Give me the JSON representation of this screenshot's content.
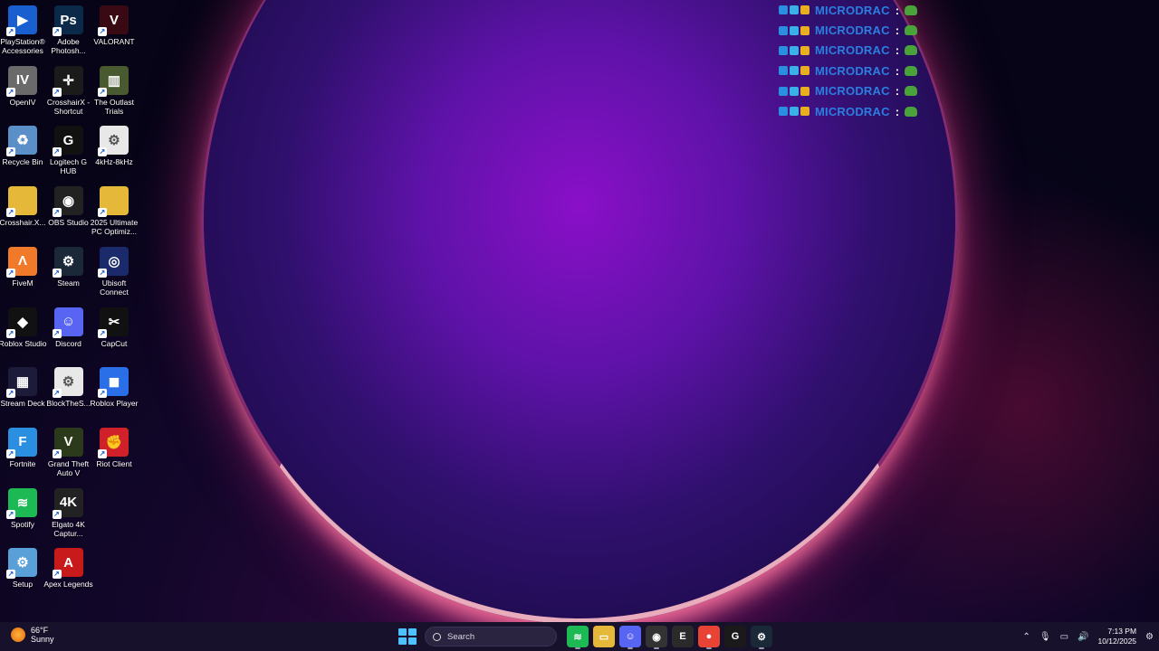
{
  "desktop": {
    "icons": [
      {
        "label": "PlayStation® Accessories",
        "glyph": "▶",
        "color": "#1a5fd0"
      },
      {
        "label": "Adobe Photosh...",
        "glyph": "Ps",
        "color": "#0b2a4a"
      },
      {
        "label": "VALORANT",
        "glyph": "V",
        "color": "#3a0a14"
      },
      {
        "label": "OpenIV",
        "glyph": "IV",
        "color": "#6a6a6a"
      },
      {
        "label": "CrosshairX - Shortcut",
        "glyph": "✛",
        "color": "#1b1b1b"
      },
      {
        "label": "The Outlast Trials",
        "glyph": "▥",
        "color": "#4a5a30"
      },
      {
        "label": "Recycle Bin",
        "glyph": "♻",
        "color": "#5a8fc8"
      },
      {
        "label": "Logitech G HUB",
        "glyph": "G",
        "color": "#111111"
      },
      {
        "label": "4kHz-8kHz",
        "glyph": "⚙",
        "color": "#e8e8e8"
      },
      {
        "label": "Crosshair.X...",
        "glyph": "",
        "color": "#e6b83a"
      },
      {
        "label": "OBS Studio",
        "glyph": "◉",
        "color": "#222222"
      },
      {
        "label": "2025 Ultimate PC Optimiz...",
        "glyph": "",
        "color": "#e6b83a"
      },
      {
        "label": "FiveM",
        "glyph": "Λ",
        "color": "#f07a2a"
      },
      {
        "label": "Steam",
        "glyph": "⚙",
        "color": "#1b2838"
      },
      {
        "label": "Ubisoft Connect",
        "glyph": "◎",
        "color": "#1a2a6a"
      },
      {
        "label": "Roblox Studio",
        "glyph": "◆",
        "color": "#111111"
      },
      {
        "label": "Discord",
        "glyph": "☺",
        "color": "#5865f2"
      },
      {
        "label": "CapCut",
        "glyph": "✂",
        "color": "#111111"
      },
      {
        "label": "Stream Deck",
        "glyph": "▦",
        "color": "#1c1c3a"
      },
      {
        "label": "BlockTheS...",
        "glyph": "⚙",
        "color": "#e8e8e8"
      },
      {
        "label": "Roblox Player",
        "glyph": "◼",
        "color": "#2b6fe8"
      },
      {
        "label": "Fortnite",
        "glyph": "F",
        "color": "#2a8fe0"
      },
      {
        "label": "Grand Theft Auto V",
        "glyph": "V",
        "color": "#2a3a1a"
      },
      {
        "label": "Riot Client",
        "glyph": "✊",
        "color": "#d0202a"
      },
      {
        "label": "Spotify",
        "glyph": "≋",
        "color": "#1db954"
      },
      {
        "label": "Elgato 4K Captur...",
        "glyph": "4K",
        "color": "#222222"
      },
      {
        "label": "",
        "glyph": "",
        "color": "transparent"
      },
      {
        "label": "Setup",
        "glyph": "⚙",
        "color": "#5aa0d8"
      },
      {
        "label": "Apex Legends",
        "glyph": "A",
        "color": "#c81a1a"
      }
    ]
  },
  "overlay": {
    "rows": [
      {
        "name": "MICRODRAC",
        "sep": ":"
      },
      {
        "name": "MICRODRAC",
        "sep": ":"
      },
      {
        "name": "MICRODRAC",
        "sep": ":"
      },
      {
        "name": "MICRODRAC",
        "sep": ":"
      },
      {
        "name": "MICRODRAC",
        "sep": ":"
      },
      {
        "name": "MICRODRAC",
        "sep": ":"
      }
    ]
  },
  "taskbar": {
    "weather_temp": "66°F",
    "weather_cond": "Sunny",
    "search_placeholder": "Search",
    "apps": [
      {
        "name": "spotify",
        "glyph": "≋",
        "color": "#1db954",
        "active": true
      },
      {
        "name": "file-explorer",
        "glyph": "▭",
        "color": "#e6b83a",
        "active": false
      },
      {
        "name": "discord",
        "glyph": "☺",
        "color": "#5865f2",
        "active": true
      },
      {
        "name": "obs",
        "glyph": "◉",
        "color": "#333333",
        "active": true
      },
      {
        "name": "epic-games",
        "glyph": "E",
        "color": "#2a2a2a",
        "active": false
      },
      {
        "name": "chrome",
        "glyph": "●",
        "color": "#e84335",
        "active": true
      },
      {
        "name": "logitech",
        "glyph": "G",
        "color": "#1a1a1a",
        "active": false
      },
      {
        "name": "steam",
        "glyph": "⚙",
        "color": "#1b2838",
        "active": true
      }
    ],
    "time": "7:13 PM",
    "date": "10/12/2025"
  }
}
